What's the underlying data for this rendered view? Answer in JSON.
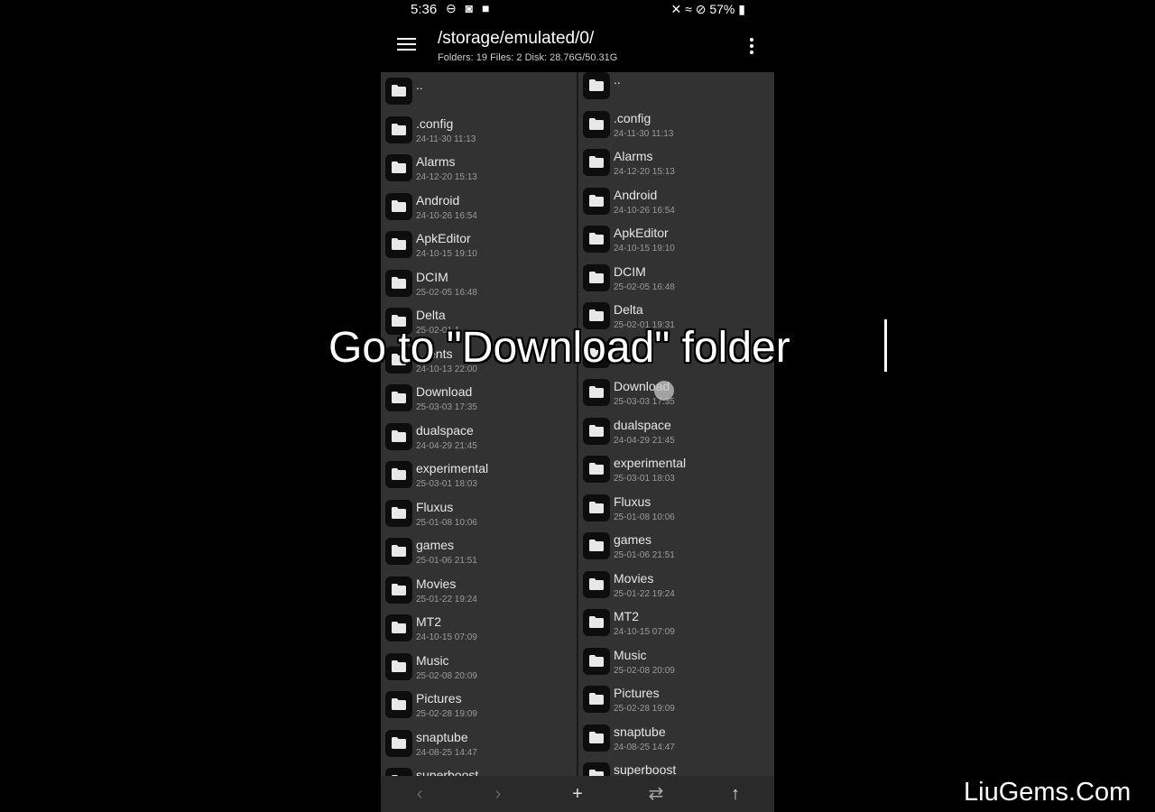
{
  "status_bar": {
    "time": "5:36",
    "battery": "57%"
  },
  "app_bar": {
    "path": "/storage/emulated/0/",
    "info": "Folders: 19  Files: 2  Disk: 28.76G/50.31G"
  },
  "left_pane": {
    "items": [
      {
        "name": "..",
        "date": ""
      },
      {
        "name": ".config",
        "date": "24-11-30 11:13"
      },
      {
        "name": "Alarms",
        "date": "24-12-20 15:13"
      },
      {
        "name": "Android",
        "date": "24-10-26 16:54"
      },
      {
        "name": "ApkEditor",
        "date": "24-10-15 19:10"
      },
      {
        "name": "DCIM",
        "date": "25-02-05 16:48"
      },
      {
        "name": "Delta",
        "date": "25-02-01 1"
      },
      {
        "name": "…ents",
        "date": "24-10-13 22:00"
      },
      {
        "name": "Download",
        "date": "25-03-03 17:35"
      },
      {
        "name": "dualspace",
        "date": "24-04-29 21:45"
      },
      {
        "name": "experimental",
        "date": "25-03-01 18:03"
      },
      {
        "name": "Fluxus",
        "date": "25-01-08 10:06"
      },
      {
        "name": "games",
        "date": "25-01-06 21:51"
      },
      {
        "name": "Movies",
        "date": "25-01-22 19:24"
      },
      {
        "name": "MT2",
        "date": "24-10-15 07:09"
      },
      {
        "name": "Music",
        "date": "25-02-08 20:09"
      },
      {
        "name": "Pictures",
        "date": "25-02-28 19:09"
      },
      {
        "name": "snaptube",
        "date": "24-08-25 14:47"
      },
      {
        "name": "superboost",
        "date": ""
      }
    ]
  },
  "right_pane": {
    "items": [
      {
        "name": "..",
        "date": ""
      },
      {
        "name": ".config",
        "date": "24-11-30 11:13"
      },
      {
        "name": "Alarms",
        "date": "24-12-20 15:13"
      },
      {
        "name": "Android",
        "date": "24-10-26 16:54"
      },
      {
        "name": "ApkEditor",
        "date": "24-10-15 19:10"
      },
      {
        "name": "DCIM",
        "date": "25-02-05 16:48"
      },
      {
        "name": "Delta",
        "date": "25-02-01 19:31"
      },
      {
        "name": "",
        "date": ""
      },
      {
        "name": "Download",
        "date": "25-03-03 17:35"
      },
      {
        "name": "dualspace",
        "date": "24-04-29 21:45"
      },
      {
        "name": "experimental",
        "date": "25-03-01 18:03"
      },
      {
        "name": "Fluxus",
        "date": "25-01-08 10:06"
      },
      {
        "name": "games",
        "date": "25-01-06 21:51"
      },
      {
        "name": "Movies",
        "date": "25-01-22 19:24"
      },
      {
        "name": "MT2",
        "date": "24-10-15 07:09"
      },
      {
        "name": "Music",
        "date": "25-02-08 20:09"
      },
      {
        "name": "Pictures",
        "date": "25-02-28 19:09"
      },
      {
        "name": "snaptube",
        "date": "24-08-25 14:47"
      },
      {
        "name": "superboost",
        "date": ""
      }
    ]
  },
  "bottom_bar": {
    "back": "‹",
    "forward": "›",
    "add": "+",
    "swap": "⇄",
    "up": "↑"
  },
  "overlay": {
    "caption": "Go to \"Download\" folder",
    "watermark": "LiuGems.Com"
  },
  "icons": {
    "folder": "folder-icon",
    "menu": "hamburger-menu-icon",
    "more": "more-vertical-icon"
  },
  "colors": {
    "pane_bg": "#323232",
    "icon_bg": "#0d0d0d",
    "text": "#e6e6e6",
    "subtext": "#9a9a9a"
  }
}
